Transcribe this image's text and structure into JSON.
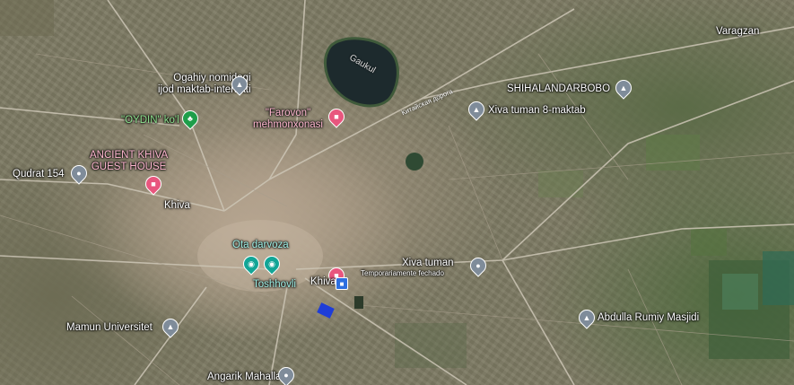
{
  "map": {
    "lake_label": "Gaukul",
    "road_label": "Китайская дорога",
    "colors": {
      "poi_pin": "#7f8c9a",
      "hotel_pin": "#e8567e",
      "park_pin": "#1e9e4a",
      "sight_pin": "#12a596",
      "transit": "#2d6fe0"
    },
    "places": {
      "varagzan": "Varagzan",
      "ogahiy_1": "Ogahiy nomidagi",
      "ogahiy_2": "ijod maktab-internati",
      "shihalandarbobo": "SHIHALANDARBOBO",
      "xiva_8_maktab": "Xiva tuman 8-maktab",
      "oydin_kol": "\"OYDIN\" ko'l",
      "farovon_1": "\"Farovon\"",
      "farovon_2": "mehmonxonasi",
      "ancient_1": "ANCIENT KHIVA",
      "ancient_2": "GUEST HOUSE",
      "qudrat": "Qudrat 154",
      "khiva_city": "Khiva",
      "ota_darvoza": "Ota darvoza",
      "toshhovli": "Toshhovli",
      "khiva_station": "Khiva",
      "xiva_tuman": "Xiva tuman",
      "xiva_tuman_status": "Temporariamente fechado",
      "abdulla": "Abdulla Rumiy Masjidi",
      "mamun": "Mamun Universitet",
      "angarik": "Angarik Mahalla"
    },
    "icons": {
      "school": "school-icon",
      "hotel": "bed-icon",
      "park": "tree-icon",
      "sight": "camera-icon",
      "mosque": "mosque-icon",
      "train": "train-icon"
    }
  }
}
